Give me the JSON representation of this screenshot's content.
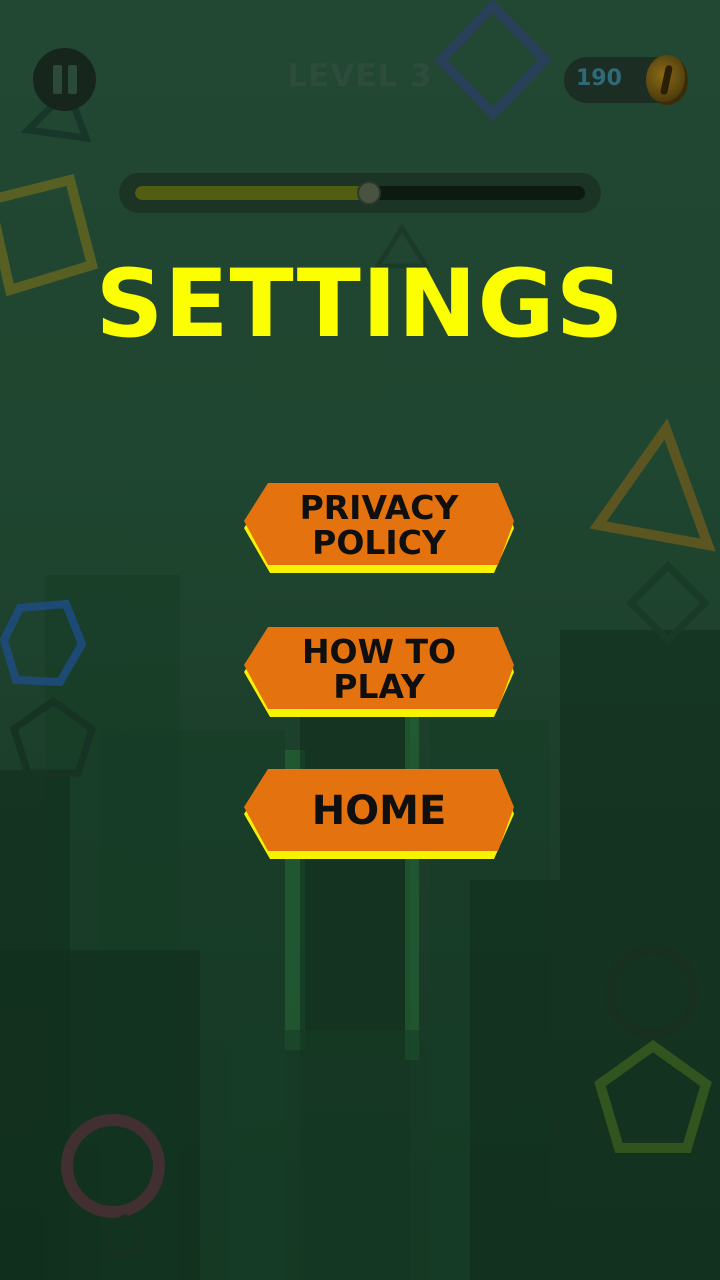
{
  "header": {
    "level_label": "LEVEL 3",
    "coins": "190"
  },
  "progress": {
    "fraction": 0.52
  },
  "title": "SETTINGS",
  "menu": {
    "privacy_label": "PRIVACY\nPOLICY",
    "howto_label": "HOW TO\nPLAY",
    "home_label": "HOME"
  },
  "icons": [
    "pause-icon",
    "coin-icon"
  ],
  "colors": {
    "title": "#fbff00",
    "button_fill": "#e4720e",
    "button_edge": "#f6f200",
    "background": "#1f4630"
  }
}
